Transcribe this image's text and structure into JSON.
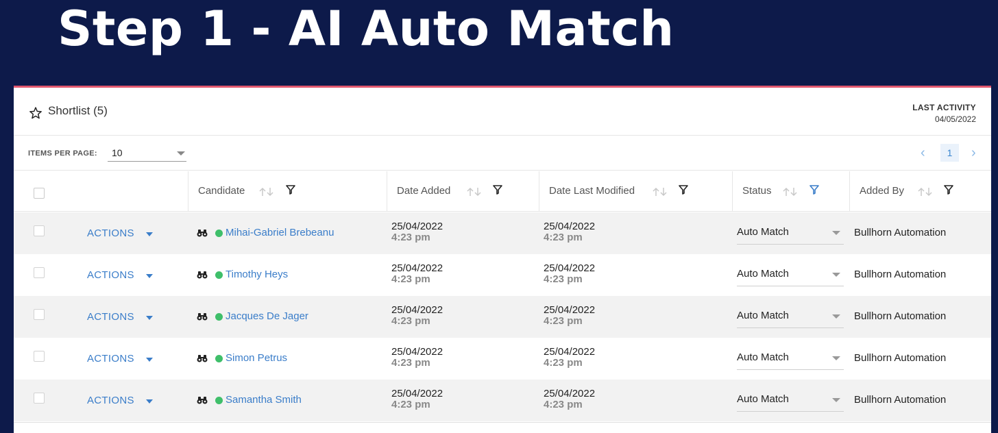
{
  "slide": {
    "title": "Step 1 - AI Auto Match"
  },
  "panel": {
    "shortlist_label": "Shortlist (5)",
    "star_icon": "star-outline-icon",
    "last_activity_label": "LAST ACTIVITY",
    "last_activity_date": "04/05/2022",
    "accent_color": "#e0576e"
  },
  "pager": {
    "items_per_page_label": "ITEMS PER PAGE:",
    "items_per_page_value": "10",
    "prev": "‹",
    "current_page": "1",
    "next": "›"
  },
  "columns": {
    "candidate": "Candidate",
    "date_added": "Date Added",
    "date_last_modified": "Date Last Modified",
    "status": "Status",
    "added_by": "Added By"
  },
  "rows": [
    {
      "actions": "ACTIONS",
      "name": "Mihai-Gabriel Brebeanu",
      "date_added": "25/04/2022",
      "time_added": "4:23 pm",
      "date_modified": "25/04/2022",
      "time_modified": "4:23 pm",
      "status": "Auto Match",
      "added_by": "Bullhorn Automation"
    },
    {
      "actions": "ACTIONS",
      "name": "Timothy Heys",
      "date_added": "25/04/2022",
      "time_added": "4:23 pm",
      "date_modified": "25/04/2022",
      "time_modified": "4:23 pm",
      "status": "Auto Match",
      "added_by": "Bullhorn Automation"
    },
    {
      "actions": "ACTIONS",
      "name": "Jacques De Jager",
      "date_added": "25/04/2022",
      "time_added": "4:23 pm",
      "date_modified": "25/04/2022",
      "time_modified": "4:23 pm",
      "status": "Auto Match",
      "added_by": "Bullhorn Automation"
    },
    {
      "actions": "ACTIONS",
      "name": "Simon Petrus",
      "date_added": "25/04/2022",
      "time_added": "4:23 pm",
      "date_modified": "25/04/2022",
      "time_modified": "4:23 pm",
      "status": "Auto Match",
      "added_by": "Bullhorn Automation"
    },
    {
      "actions": "ACTIONS",
      "name": "Samantha Smith",
      "date_added": "25/04/2022",
      "time_added": "4:23 pm",
      "date_modified": "25/04/2022",
      "time_modified": "4:23 pm",
      "status": "Auto Match",
      "added_by": "Bullhorn Automation"
    }
  ],
  "colors": {
    "background": "#0d1a4a",
    "link": "#3a7dc9",
    "online_dot": "#3fbf6a",
    "status_filter_active": "#3a7dc9"
  }
}
